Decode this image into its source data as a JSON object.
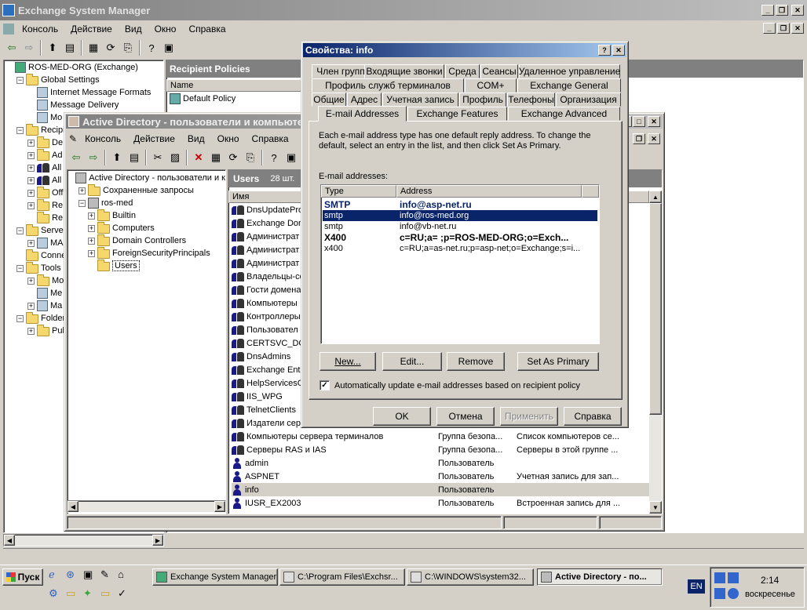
{
  "esm": {
    "title": "Exchange System Manager",
    "menu": [
      "Консоль",
      "Действие",
      "Вид",
      "Окно",
      "Справка"
    ],
    "tree": [
      {
        "label": "ROS-MED-ORG (Exchange)"
      },
      {
        "label": "Global Settings"
      },
      {
        "label": "Internet Message Formats"
      },
      {
        "label": "Message Delivery"
      },
      {
        "label": "Mo"
      },
      {
        "label": "Recipie"
      },
      {
        "label": "De"
      },
      {
        "label": "Ad"
      },
      {
        "label": "All"
      },
      {
        "label": "All"
      },
      {
        "label": "Off"
      },
      {
        "label": "Re"
      },
      {
        "label": "Re"
      },
      {
        "label": "Server"
      },
      {
        "label": "MA"
      },
      {
        "label": "Conne"
      },
      {
        "label": "Tools"
      },
      {
        "label": "Mo"
      },
      {
        "label": "Me"
      },
      {
        "label": "Ma"
      },
      {
        "label": "Folders"
      },
      {
        "label": "Pul"
      }
    ],
    "right_header": "Recipient Policies",
    "right_col": "Name",
    "right_item": "Default Policy"
  },
  "ad": {
    "title": "Active Directory - пользователи и компьютеры",
    "menu": [
      "Консоль",
      "Действие",
      "Вид",
      "Окно",
      "Справка"
    ],
    "tree": [
      {
        "label": "Active Directory - пользователи и к"
      },
      {
        "label": "Сохраненные запросы"
      },
      {
        "label": "ros-med"
      },
      {
        "label": "Builtin"
      },
      {
        "label": "Computers"
      },
      {
        "label": "Domain Controllers"
      },
      {
        "label": "ForeignSecurityPrincipals"
      },
      {
        "label": "Users"
      }
    ],
    "list_title": "Users",
    "list_count": "28 шт.",
    "col_name": "Имя",
    "rows": [
      {
        "name": "DnsUpdatePro",
        "type": "",
        "desc": "",
        "kind": "group"
      },
      {
        "name": "Exchange Dom",
        "type": "",
        "desc": "",
        "kind": "group"
      },
      {
        "name": "Администрат",
        "type": "",
        "desc": "",
        "kind": "group"
      },
      {
        "name": "Администрат",
        "type": "",
        "desc": "",
        "kind": "group"
      },
      {
        "name": "Администрат",
        "type": "",
        "desc": "",
        "kind": "group"
      },
      {
        "name": "Владельцы-со",
        "type": "",
        "desc": "",
        "kind": "group"
      },
      {
        "name": "Гости домена",
        "type": "",
        "desc": "",
        "kind": "group"
      },
      {
        "name": "Компьютеры",
        "type": "",
        "desc": "",
        "kind": "group"
      },
      {
        "name": "Контроллеры",
        "type": "",
        "desc": "",
        "kind": "group"
      },
      {
        "name": "Пользовател",
        "type": "",
        "desc": "",
        "kind": "group"
      },
      {
        "name": "CERTSVC_DC",
        "type": "",
        "desc": "",
        "kind": "group"
      },
      {
        "name": "DnsAdmins",
        "type": "",
        "desc": "",
        "kind": "group"
      },
      {
        "name": "Exchange Ente",
        "type": "",
        "desc": "",
        "kind": "group"
      },
      {
        "name": "HelpServicesG",
        "type": "",
        "desc": "",
        "kind": "group"
      },
      {
        "name": "IIS_WPG",
        "type": "",
        "desc": "",
        "kind": "group"
      },
      {
        "name": "TelnetClients",
        "type": "",
        "desc": "",
        "kind": "group"
      },
      {
        "name": "Издатели сер",
        "type": "",
        "desc": "",
        "kind": "group"
      },
      {
        "name": "Компьютеры сервера терминалов",
        "type": "Группа безопа...",
        "desc": "Список компьютеров се...",
        "kind": "group"
      },
      {
        "name": "Серверы RAS и IAS",
        "type": "Группа безопа...",
        "desc": "Серверы в этой группе ...",
        "kind": "group"
      },
      {
        "name": "admin",
        "type": "Пользователь",
        "desc": "",
        "kind": "user"
      },
      {
        "name": "ASPNET",
        "type": "Пользователь",
        "desc": "Учетная запись для зап...",
        "kind": "user"
      },
      {
        "name": "info",
        "type": "Пользователь",
        "desc": "",
        "kind": "user"
      },
      {
        "name": "IUSR_EX2003",
        "type": "Пользователь",
        "desc": "Встроенная запись для ...",
        "kind": "user"
      }
    ]
  },
  "dialog": {
    "title": "Свойства: info",
    "tabs_row1": [
      "Член групп",
      "Входящие звонки",
      "Среда",
      "Сеансы",
      "Удаленное управление"
    ],
    "tabs_row2": [
      "Профиль служб терминалов",
      "COM+",
      "Exchange General"
    ],
    "tabs_row3": [
      "Общие",
      "Адрес",
      "Учетная запись",
      "Профиль",
      "Телефоны",
      "Организация"
    ],
    "tabs_row4": [
      "E-mail Addresses",
      "Exchange Features",
      "Exchange Advanced"
    ],
    "description": "Each e-mail address type has one default reply address. To change the default, select an entry in the list, and then click Set As Primary.",
    "list_label": "E-mail addresses:",
    "col_type": "Type",
    "col_address": "Address",
    "addresses": [
      {
        "type": "SMTP",
        "address": "info@asp-net.ru",
        "primary": true,
        "selected": false
      },
      {
        "type": "smtp",
        "address": "info@ros-med.org",
        "primary": false,
        "selected": true
      },
      {
        "type": "smtp",
        "address": "info@vb-net.ru",
        "primary": false,
        "selected": false
      },
      {
        "type": "X400",
        "address": "c=RU;a= ;p=ROS-MED-ORG;o=Exch...",
        "primary": true,
        "selected": false
      },
      {
        "type": "x400",
        "address": "c=RU;a=as-net.ru;p=asp-net;o=Exchange;s=i...",
        "primary": false,
        "selected": false
      }
    ],
    "buttons": {
      "new": "New...",
      "edit": "Edit...",
      "remove": "Remove",
      "set_primary": "Set As Primary"
    },
    "checkbox_label": "Automatically update e-mail addresses based on recipient policy",
    "checkbox_checked": true,
    "footer": {
      "ok": "OK",
      "cancel": "Отмена",
      "apply": "Применить",
      "help": "Справка"
    }
  },
  "taskbar": {
    "start": "Пуск",
    "items": [
      "Exchange System Manager",
      "C:\\Program Files\\Exchsr...",
      "C:\\WINDOWS\\system32...",
      "Active Directory - по..."
    ],
    "lang": "EN",
    "time": "2:14",
    "day": "воскресенье"
  }
}
